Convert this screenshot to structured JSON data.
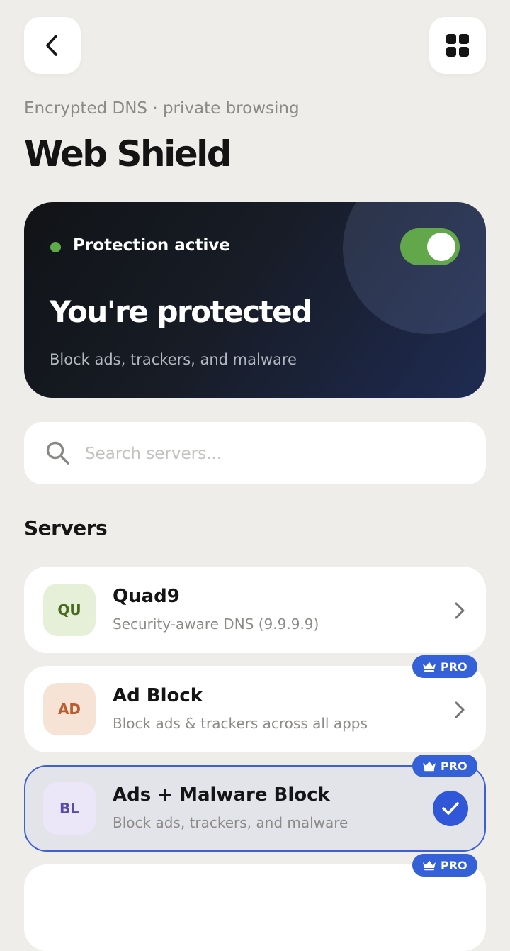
{
  "header": {
    "back_icon": "chevron-left-icon",
    "menu_icon": "grid-icon",
    "subtitle": "Encrypted DNS · private browsing",
    "title": "Web Shield"
  },
  "hero": {
    "status_label": "Protection active",
    "status_color": "#5ea948",
    "toggle_on": true,
    "toggle_color": "#62a84a",
    "headline": "You're protected",
    "description": "Block ads, trackers, and malware"
  },
  "search": {
    "placeholder": "Search servers...",
    "value": ""
  },
  "servers_section": {
    "title": "Servers",
    "items": [
      {
        "initials": "QU",
        "name": "Quad9",
        "description": "Security-aware DNS (9.9.9.9)",
        "pro": false,
        "selected": false,
        "avatar_bg": "#e6f0d8",
        "avatar_fg": "#4a6b1f"
      },
      {
        "initials": "AD",
        "name": "Ad Block",
        "description": "Block ads & trackers across all apps",
        "pro": true,
        "pro_label": "PRO",
        "selected": false,
        "avatar_bg": "#f7e2d6",
        "avatar_fg": "#b85d32"
      },
      {
        "initials": "BL",
        "name": "Ads + Malware Block",
        "description": "Block ads, trackers, and malware",
        "pro": true,
        "pro_label": "PRO",
        "selected": true,
        "avatar_bg": "#ebe6f8",
        "avatar_fg": "#5b4aa8"
      }
    ],
    "next_item_badge": "PRO"
  },
  "colors": {
    "accent": "#3460d8",
    "background": "#efedea"
  }
}
